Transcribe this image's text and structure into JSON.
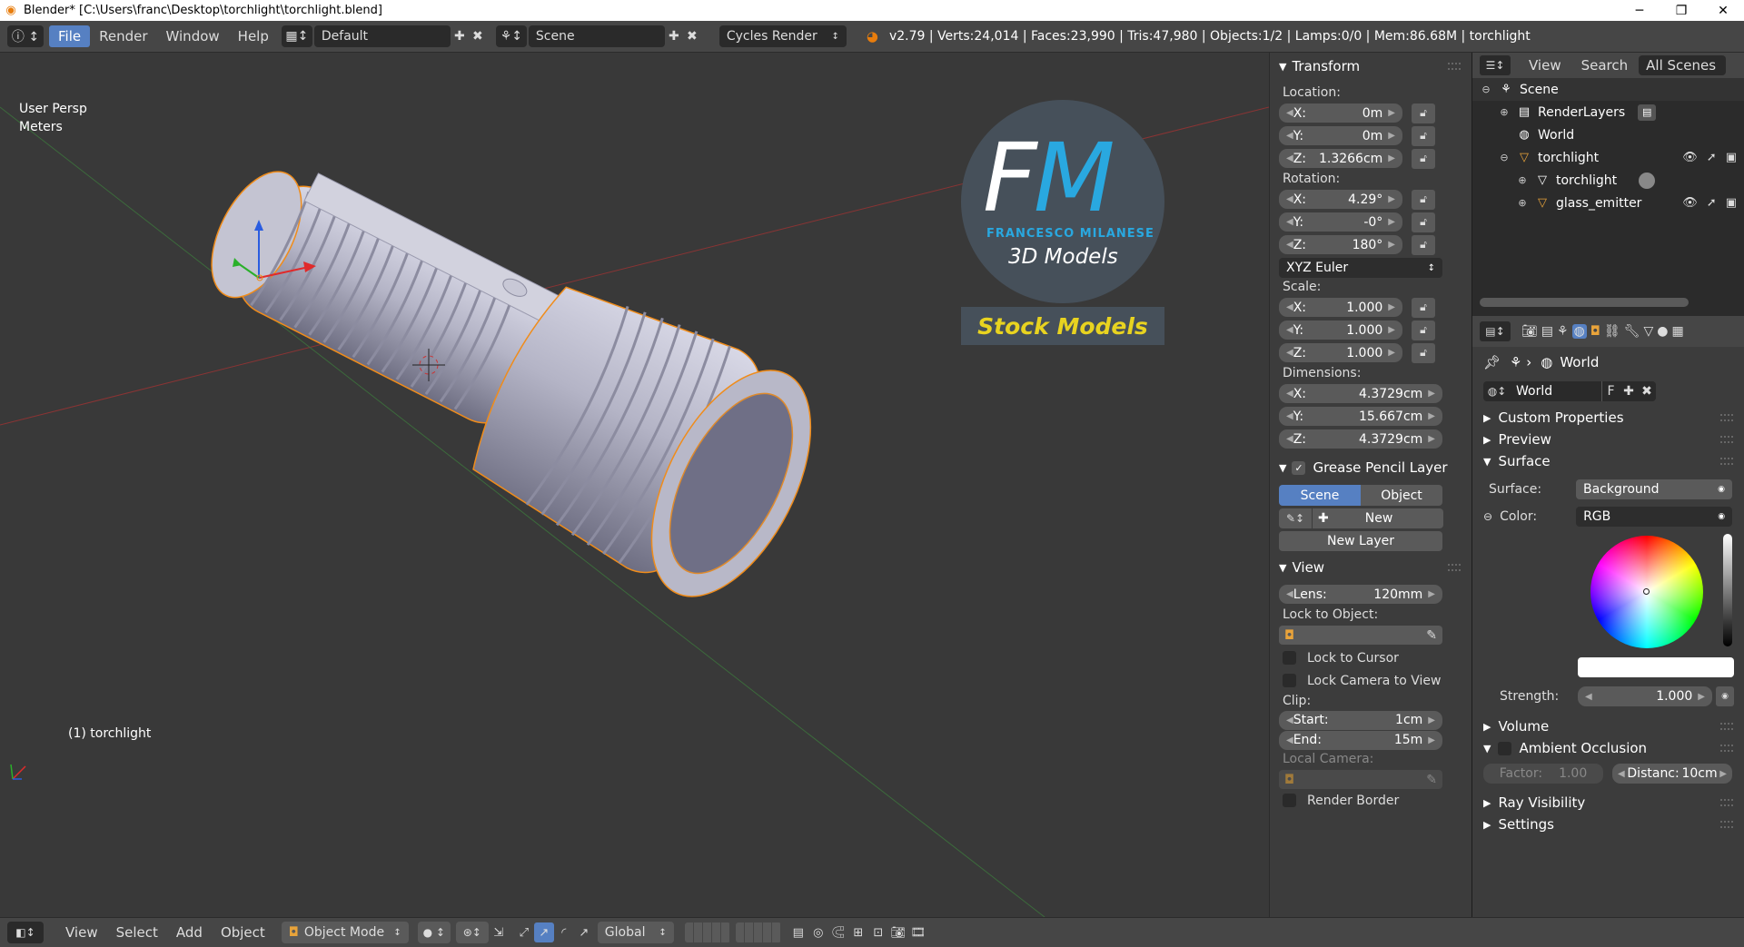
{
  "window": {
    "title": "Blender* [C:\\Users\\franc\\Desktop\\torchlight\\torchlight.blend]",
    "minimize": "─",
    "maximize": "❐",
    "close": "✕"
  },
  "info_header": {
    "menus": [
      "File",
      "Render",
      "Window",
      "Help"
    ],
    "layout": "Default",
    "scene": "Scene",
    "engine": "Cycles Render",
    "stats": "v2.79 | Verts:24,014 | Faces:23,990 | Tris:47,980 | Objects:1/2 | Lamps:0/0 | Mem:86.68M | torchlight"
  },
  "viewport": {
    "view_name": "User Persp",
    "units": "Meters",
    "object_label": "(1) torchlight",
    "watermark": {
      "initials_f": "F",
      "initials_m": "M",
      "author": "FRANCESCO MILANESE",
      "tagline": "3D Models",
      "banner": "Stock Models"
    }
  },
  "n_panel": {
    "transform_title": "Transform",
    "location_label": "Location:",
    "location": [
      {
        "axis": "X:",
        "value": "0m"
      },
      {
        "axis": "Y:",
        "value": "0m"
      },
      {
        "axis": "Z:",
        "value": "1.3266cm"
      }
    ],
    "rotation_label": "Rotation:",
    "rotation": [
      {
        "axis": "X:",
        "value": "4.29°"
      },
      {
        "axis": "Y:",
        "value": "-0°"
      },
      {
        "axis": "Z:",
        "value": "180°"
      }
    ],
    "rotation_mode": "XYZ Euler",
    "scale_label": "Scale:",
    "scale": [
      {
        "axis": "X:",
        "value": "1.000"
      },
      {
        "axis": "Y:",
        "value": "1.000"
      },
      {
        "axis": "Z:",
        "value": "1.000"
      }
    ],
    "dimensions_label": "Dimensions:",
    "dimensions": [
      {
        "axis": "X:",
        "value": "4.3729cm"
      },
      {
        "axis": "Y:",
        "value": "15.667cm"
      },
      {
        "axis": "Z:",
        "value": "4.3729cm"
      }
    ],
    "grease_title": "Grease Pencil Layer",
    "grease_scene": "Scene",
    "grease_object": "Object",
    "grease_new": "New",
    "grease_new_layer": "New Layer",
    "view_title": "View",
    "lens_label": "Lens:",
    "lens_value": "120mm",
    "lock_to_object": "Lock to Object:",
    "lock_to_cursor": "Lock to Cursor",
    "lock_camera": "Lock Camera to View",
    "clip_label": "Clip:",
    "clip_start_label": "Start:",
    "clip_start": "1cm",
    "clip_end_label": "End:",
    "clip_end": "15m",
    "local_camera": "Local Camera:",
    "render_border": "Render Border"
  },
  "outliner": {
    "view": "View",
    "search": "Search",
    "filter": "All Scenes",
    "items": [
      "Scene",
      "RenderLayers",
      "World",
      "torchlight",
      "torchlight",
      "glass_emitter"
    ]
  },
  "properties": {
    "context": "World",
    "datablock": "World",
    "fake_user": "F",
    "sections": {
      "custom_properties": "Custom Properties",
      "preview": "Preview",
      "surface": "Surface",
      "volume": "Volume",
      "ambient_occlusion": "Ambient Occlusion",
      "ray_visibility": "Ray Visibility",
      "settings": "Settings"
    },
    "surface_label": "Surface:",
    "surface_value": "Background",
    "color_label": "Color:",
    "color_value": "RGB",
    "strength_label": "Strength:",
    "strength_value": "1.000",
    "factor_label": "Factor:",
    "factor_value": "1.00",
    "distance_label": "Distanc:",
    "distance_value": "10cm"
  },
  "bottom_header": {
    "menus": [
      "View",
      "Select",
      "Add",
      "Object"
    ],
    "mode": "Object Mode",
    "orientation": "Global"
  },
  "colors": {
    "accent": "#5680c2",
    "viewport_bg": "#393939",
    "panel_bg": "#3c3c3c",
    "header_bg": "#464646",
    "logo_cyan": "#29a8e0",
    "banner_yellow": "#e8d320",
    "selection_outline": "#f08c1a"
  }
}
